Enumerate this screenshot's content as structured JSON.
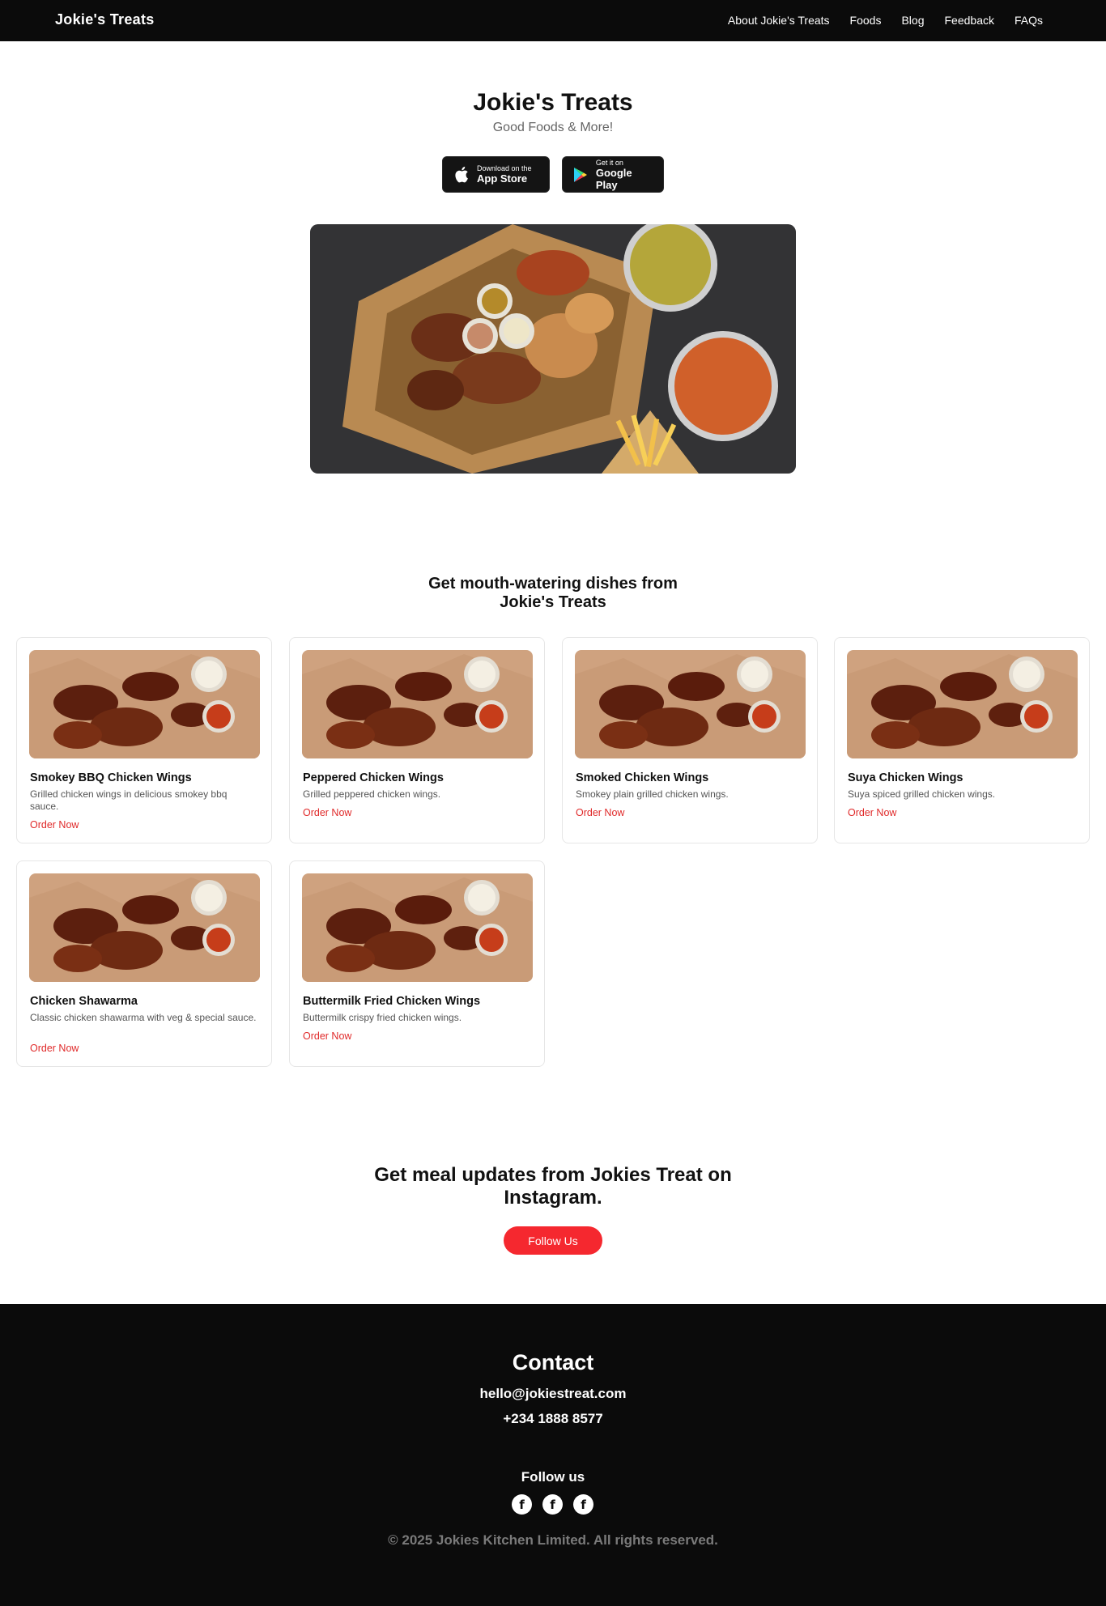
{
  "nav": {
    "brand": "Jokie's Treats",
    "links": [
      "About Jokie's Treats",
      "Foods",
      "Blog",
      "Feedback",
      "FAQs"
    ]
  },
  "hero": {
    "title": "Jokie's Treats",
    "subtitle": "Good Foods & More!",
    "app_store": {
      "small": "Download on the",
      "big": "App Store",
      "icon": "apple-icon"
    },
    "google_play": {
      "small": "Get it on",
      "big": "Google Play",
      "icon": "google-play-icon"
    }
  },
  "dishes": {
    "title_line1": "Get mouth-watering dishes from",
    "title_line2": "Jokie's Treats",
    "order_label": "Order Now",
    "items": [
      {
        "name": "Smokey BBQ Chicken Wings",
        "desc": "Grilled chicken wings in delicious smokey bbq sauce."
      },
      {
        "name": "Peppered Chicken Wings",
        "desc": "Grilled peppered chicken wings."
      },
      {
        "name": "Smoked Chicken Wings",
        "desc": "Smokey plain grilled chicken wings."
      },
      {
        "name": "Suya Chicken Wings",
        "desc": "Suya spiced grilled chicken wings."
      },
      {
        "name": "Chicken Shawarma",
        "desc": "Classic chicken shawarma with veg & special sauce."
      },
      {
        "name": "Buttermilk Fried Chicken Wings",
        "desc": "Buttermilk crispy fried chicken wings."
      }
    ]
  },
  "instagram": {
    "title_line1": "Get meal updates from Jokies Treat on",
    "title_line2": "Instagram.",
    "button": "Follow Us"
  },
  "footer": {
    "contact_title": "Contact",
    "email": "hello@jokiestreat.com",
    "phone": "+234 1888 8577",
    "follow_title": "Follow us",
    "socials": [
      "facebook-icon",
      "facebook-icon",
      "facebook-icon"
    ],
    "copyright": "© 2025 Jokies Kitchen Limited. All rights reserved."
  },
  "colors": {
    "nav_bg": "#0b0b0b",
    "accent_red": "#f5282f",
    "order_link": "#e02a2a"
  }
}
